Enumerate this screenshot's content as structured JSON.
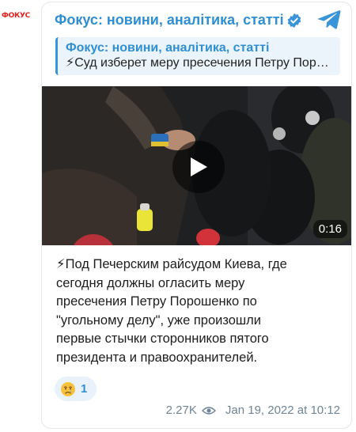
{
  "avatar": {
    "label": "ФОКУС"
  },
  "header": {
    "channel_title": "Фокус: новини, аналітика, статті"
  },
  "reply": {
    "title": "Фокус: новини, аналітика, статті",
    "text": "⚡Суд изберет меру пресечения Петру Порошенко"
  },
  "video": {
    "duration": "0:16"
  },
  "message": {
    "text": "⚡Под Печерским райсудом Киева, где\nсегодня должны огласить меру\nпресечения Петру Порошенко по\n\"угольному делу\", уже произошли\nпервые стычки сторонников пятого\nпрезидента и правоохранителей."
  },
  "reaction": {
    "emoji": "crying-face-icon",
    "count": "1"
  },
  "meta": {
    "views": "2.27K",
    "date": "Jan 19, 2022 at 10:12"
  },
  "colors": {
    "accent": "#2f8fd2",
    "reply_bg": "#ebf4fb",
    "reaction_bg": "#e9f2fb",
    "meta_text": "#6f8597",
    "brand_red": "#e2211c"
  }
}
